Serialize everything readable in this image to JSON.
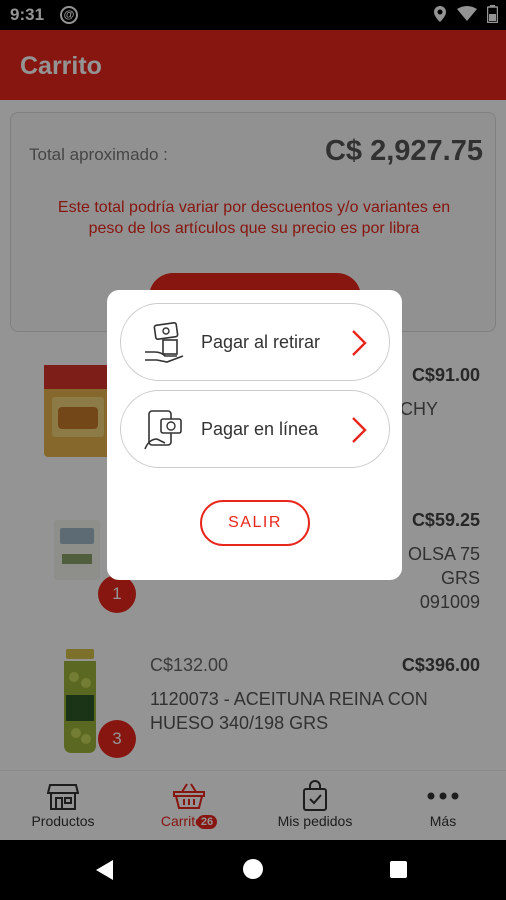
{
  "status_bar": {
    "time": "9:31"
  },
  "app_bar": {
    "title": "Carrito"
  },
  "summary": {
    "total_label": "Total aproximado :",
    "total_value": "C$ 2,927.75",
    "note": "Este total podría variar por descuentos y/o variantes en peso de los artículos que su precio es por libra"
  },
  "items": [
    {
      "unit_price": "",
      "total": "C$91.00",
      "name": "CHY",
      "quantity": ""
    },
    {
      "unit_price": "",
      "total": "C$59.25",
      "name": "OLSA 75 GRS 091009",
      "quantity": "1"
    },
    {
      "unit_price": "C$132.00",
      "total": "C$396.00",
      "name": "1120073 - ACEITUNA REINA CON HUESO 340/198 GRS",
      "quantity": "3"
    }
  ],
  "dialog": {
    "option_pickup": "Pagar al retirar",
    "option_online": "Pagar en línea",
    "exit_label": "SALIR"
  },
  "bottom_nav": {
    "products": "Productos",
    "cart": "Carrito",
    "cart_badge": "26",
    "orders": "Mis pedidos",
    "more": "Más"
  },
  "colors": {
    "brand": "#e8261c"
  },
  "icons": [
    "location-icon",
    "wifi-icon",
    "battery-icon",
    "store-icon",
    "basket-icon",
    "bag-check-icon",
    "more-dots-icon",
    "cash-hand-icon",
    "phone-card-icon",
    "chevron-right-icon"
  ]
}
